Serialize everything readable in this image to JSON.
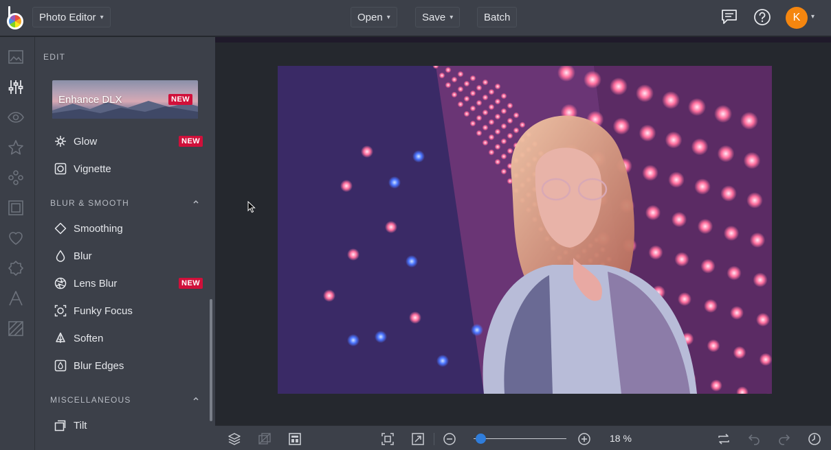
{
  "app": {
    "title": "Photo Editor",
    "menu": {
      "open": "Open",
      "save": "Save",
      "batch": "Batch"
    },
    "avatar_initial": "K"
  },
  "rail": {
    "icons": [
      "image-icon",
      "sliders-icon",
      "eye-icon",
      "star-icon",
      "shapes-icon",
      "frame-icon",
      "heart-icon",
      "badge-icon",
      "text-icon",
      "texture-icon"
    ],
    "active": "sliders-icon"
  },
  "panel": {
    "edit_header": "EDIT",
    "banner": {
      "label": "Enhance DLX",
      "badge": "NEW"
    },
    "edit_items": [
      {
        "label": "Glow",
        "badge": "NEW"
      },
      {
        "label": "Vignette"
      }
    ],
    "blur_header": "BLUR & SMOOTH",
    "blur_items": [
      {
        "label": "Smoothing"
      },
      {
        "label": "Blur"
      },
      {
        "label": "Lens Blur",
        "badge": "NEW"
      },
      {
        "label": "Funky Focus"
      },
      {
        "label": "Soften"
      },
      {
        "label": "Blur Edges"
      }
    ],
    "misc_header": "MISCELLANEOUS",
    "misc_items": [
      {
        "label": "Tilt"
      }
    ]
  },
  "bottom": {
    "zoom_label": "18 %",
    "zoom_level": 0.08
  },
  "colors": {
    "accent": "#2f7ddb",
    "badge": "#d0103a",
    "avatar": "#f5860f"
  }
}
